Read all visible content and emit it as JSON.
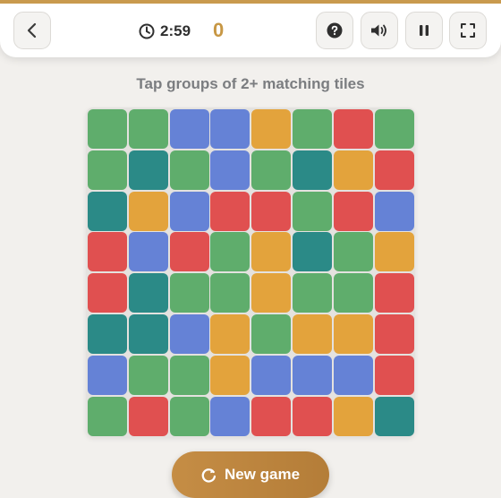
{
  "header": {
    "back_icon": "chevron-left-icon",
    "timer_icon": "clock-icon",
    "timer": "2:59",
    "score": "0",
    "help_icon": "question-circle-icon",
    "sound_icon": "speaker-on-icon",
    "pause_icon": "pause-icon",
    "fullscreen_icon": "fullscreen-icon"
  },
  "instructions": "Tap groups of 2+ matching tiles",
  "board": {
    "rows": 8,
    "cols": 8,
    "colors": {
      "green": "#5fad6c",
      "teal": "#2b8a87",
      "blue": "#6582d6",
      "orange": "#e3a33c",
      "red": "#e05050"
    },
    "grid": [
      [
        "green",
        "green",
        "blue",
        "blue",
        "orange",
        "green",
        "red",
        "green"
      ],
      [
        "green",
        "teal",
        "green",
        "blue",
        "green",
        "teal",
        "orange",
        "red"
      ],
      [
        "teal",
        "orange",
        "blue",
        "red",
        "red",
        "green",
        "red",
        "blue"
      ],
      [
        "red",
        "blue",
        "red",
        "green",
        "orange",
        "teal",
        "green",
        "orange"
      ],
      [
        "red",
        "teal",
        "green",
        "green",
        "orange",
        "green",
        "green",
        "red"
      ],
      [
        "teal",
        "teal",
        "blue",
        "orange",
        "green",
        "orange",
        "orange",
        "red"
      ],
      [
        "blue",
        "green",
        "green",
        "orange",
        "blue",
        "blue",
        "blue",
        "red"
      ],
      [
        "green",
        "red",
        "green",
        "blue",
        "red",
        "red",
        "orange",
        "teal"
      ]
    ]
  },
  "new_game": {
    "label": "New game",
    "icon": "restart-icon"
  },
  "accent_color": "#c99a4e"
}
